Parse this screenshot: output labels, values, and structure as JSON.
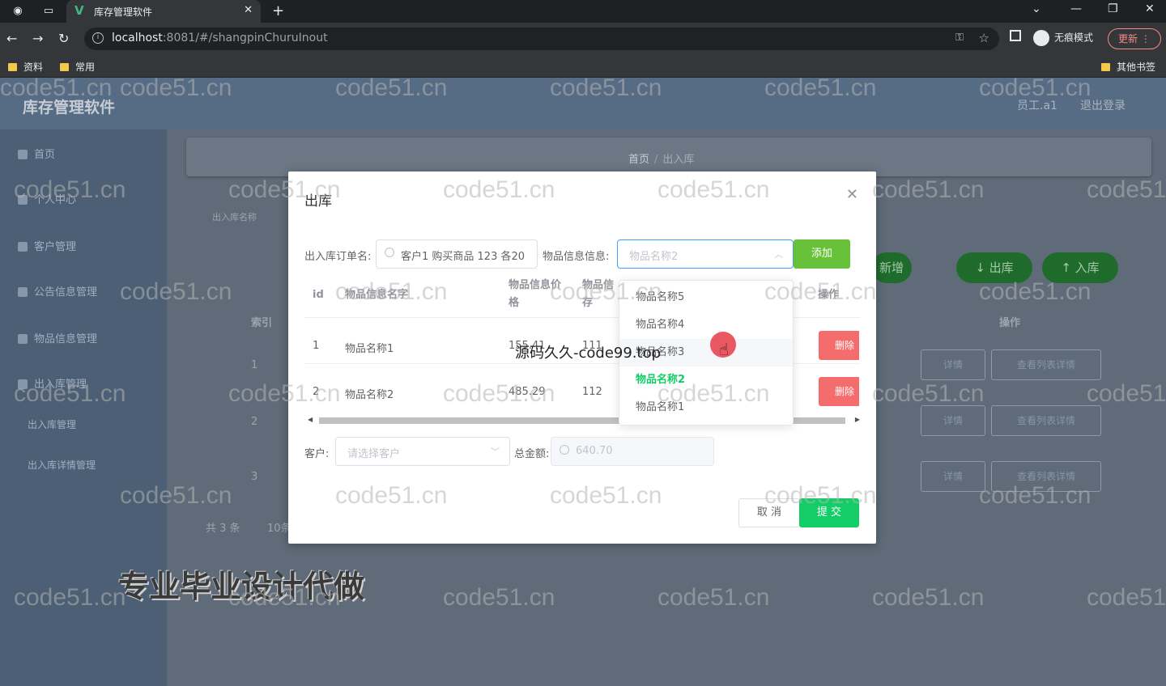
{
  "browser": {
    "tab_title": "库存管理软件",
    "url_host": "localhost",
    "url_rest": ":8081/#/shangpinChuruInout",
    "incognito_label": "无痕模式",
    "update_label": "更新",
    "bookmarks": [
      "资料",
      "常用"
    ],
    "other_bookmarks": "其他书签"
  },
  "app": {
    "title": "库存管理软件",
    "user": "员工.a1",
    "logout": "退出登录",
    "sidebar": [
      {
        "label": "首页"
      },
      {
        "label": "个人中心"
      },
      {
        "label": "客户管理"
      },
      {
        "label": "公告信息管理"
      },
      {
        "label": "物品信息管理"
      },
      {
        "label": "出入库管理"
      }
    ],
    "sidebar_sub": [
      "出入库管理",
      "出入库详情管理"
    ],
    "breadcrumb": {
      "home": "首页",
      "current": "出入库"
    },
    "search_hint": "出入库名称",
    "buttons": {
      "add": "新增",
      "out": "出库",
      "in": "入库"
    },
    "table_headers": {
      "index": "索引",
      "op": "操作"
    },
    "rows": [
      "1",
      "2",
      "3"
    ],
    "row_buttons": {
      "detail": "详情",
      "list_detail": "查看列表详情"
    },
    "pager_total": "共 3 条",
    "pager_size": "10条"
  },
  "modal": {
    "title": "出库",
    "order_label": "出入库订单名:",
    "order_value": "客户1 购买商品 123 各20",
    "goods_label": "物品信息信息:",
    "goods_placeholder": "物品名称2",
    "add_button": "添加",
    "headers": {
      "id": "id",
      "name": "物品信息名字",
      "price": "物品信息价格",
      "stock": "物品信存",
      "op": "操作"
    },
    "rows": [
      {
        "id": "1",
        "name": "物品名称1",
        "price": "155.41",
        "stock": "111",
        "op": "删除"
      },
      {
        "id": "2",
        "name": "物品名称2",
        "price": "485.29",
        "stock": "112",
        "op": "删除"
      }
    ],
    "customer_label": "客户:",
    "customer_placeholder": "请选择客户",
    "total_label": "总金额:",
    "total_value": "640.70",
    "cancel": "取 消",
    "submit": "提 交"
  },
  "dropdown": {
    "options": [
      "物品名称5",
      "物品名称4",
      "物品名称3",
      "物品名称2",
      "物品名称1"
    ],
    "selected": "物品名称2"
  },
  "overlay": {
    "watermark": "code51.cn",
    "caption": "源码久久-code99.top",
    "promo": "专业毕业设计代做"
  }
}
